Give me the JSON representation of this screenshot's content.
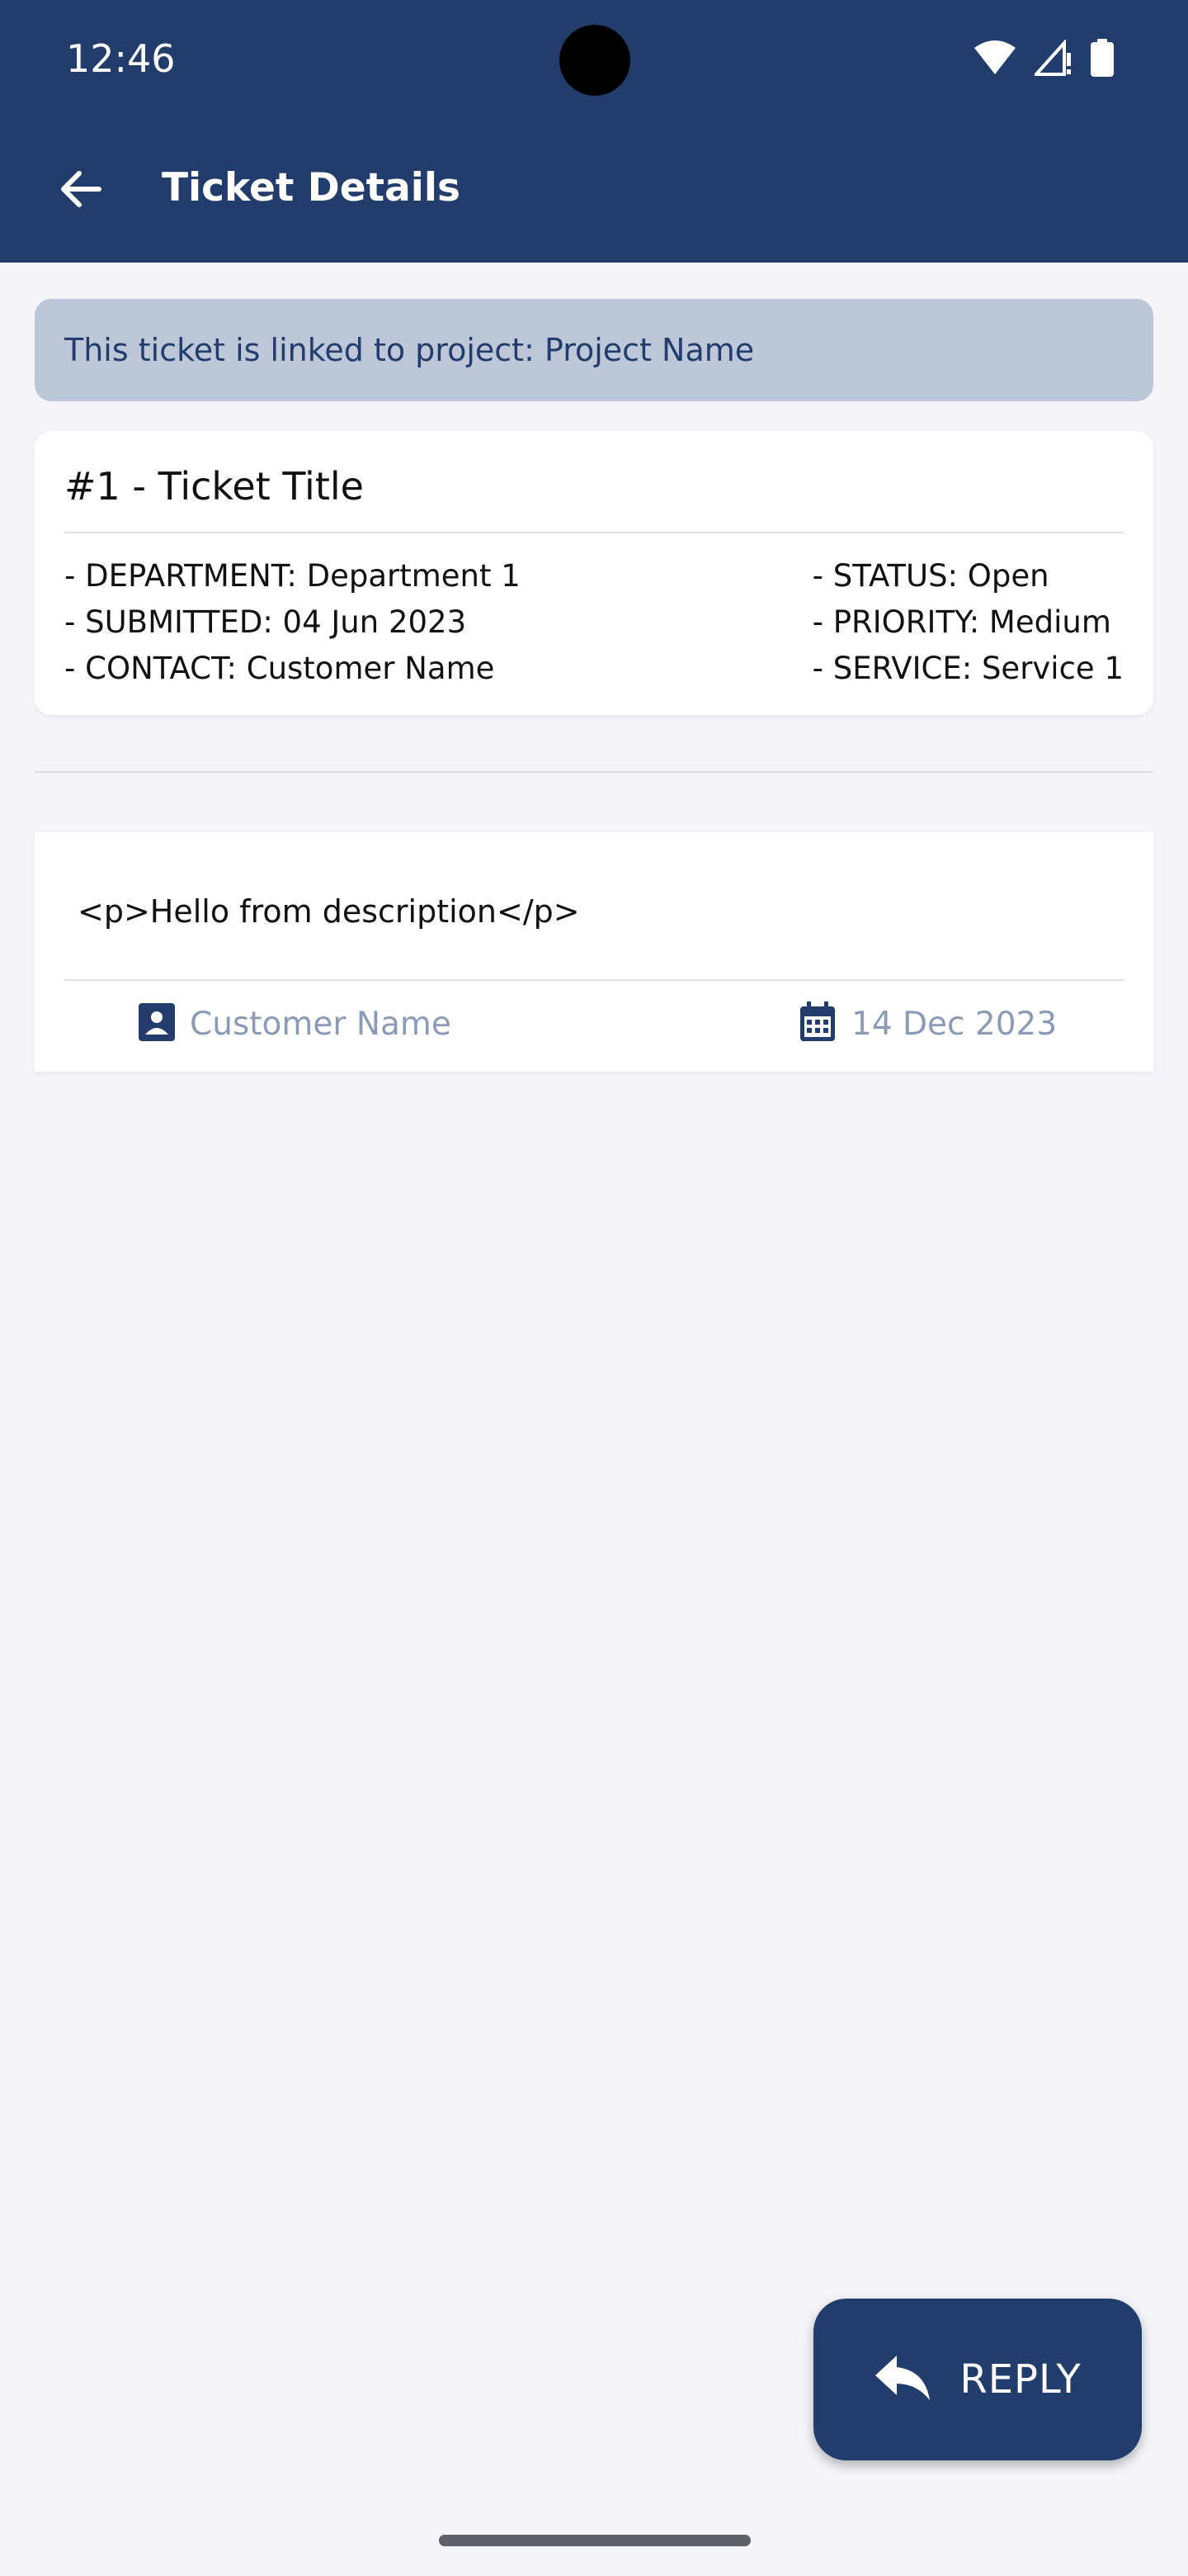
{
  "status_bar": {
    "time": "12:46",
    "icons": [
      "wifi-icon",
      "cellular-signal-icon",
      "battery-icon"
    ]
  },
  "app_bar": {
    "title": "Ticket Details",
    "back_icon": "arrow-back-icon"
  },
  "project_banner": {
    "text": "This ticket is linked to project: Project Name"
  },
  "ticket": {
    "title": "#1 - Ticket Title",
    "meta_left": [
      "- DEPARTMENT: Department 1",
      "- SUBMITTED: 04 Jun 2023",
      "- CONTACT: Customer Name"
    ],
    "meta_right": [
      "- STATUS: Open",
      "- PRIORITY: Medium",
      "- SERVICE: Service 1"
    ]
  },
  "message": {
    "body": "<p>Hello from description</p>",
    "author": "Customer Name",
    "date": "14 Dec 2023",
    "author_icon": "contact-card-icon",
    "date_icon": "calendar-icon"
  },
  "reply_button": {
    "label": "REPLY",
    "icon": "reply-arrow-icon"
  },
  "colors": {
    "primary": "#223c6b",
    "banner_bg": "#bdc7d8",
    "muted_text": "#8c9bb5",
    "page_bg": "#f3f5fa"
  }
}
